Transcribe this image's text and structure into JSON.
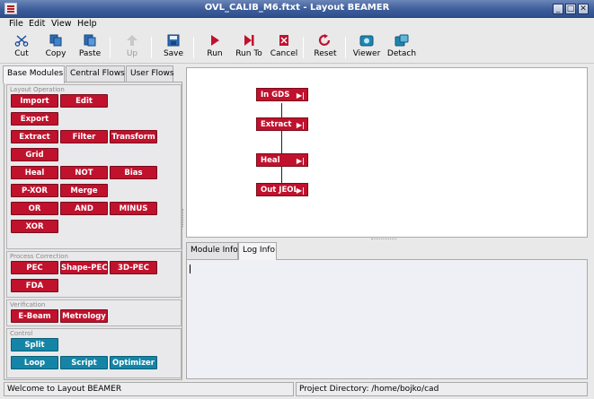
{
  "window": {
    "title": "OVL_CALIB_M6.ftxt - Layout BEAMER"
  },
  "menu": [
    "File",
    "Edit",
    "View",
    "Help"
  ],
  "toolbar": {
    "cut": "Cut",
    "copy": "Copy",
    "paste": "Paste",
    "up": "Up",
    "save": "Save",
    "run": "Run",
    "run_to": "Run To",
    "cancel": "Cancel",
    "reset": "Reset",
    "viewer": "Viewer",
    "detach": "Detach"
  },
  "left_tabs": [
    "Base Modules",
    "Central Flows",
    "User Flows"
  ],
  "groups": {
    "layout_operation": {
      "title": "Layout Operation",
      "modules": [
        "Import",
        "Edit",
        "Export",
        "Extract",
        "Filter",
        "Transform",
        "Grid",
        "Heal",
        "NOT",
        "Bias",
        "P-XOR",
        "Merge",
        "OR",
        "AND",
        "MINUS",
        "XOR"
      ]
    },
    "process_correction": {
      "title": "Process Correction",
      "modules": [
        "PEC",
        "Shape-PEC",
        "3D-PEC",
        "FDA"
      ]
    },
    "verification": {
      "title": "Verification",
      "modules": [
        "E-Beam",
        "Metrology"
      ]
    },
    "control": {
      "title": "Control",
      "modules": [
        "Split",
        "Loop",
        "Script",
        "Optimizer"
      ]
    }
  },
  "flow_nodes": [
    "In GDS",
    "Extract",
    "Heal",
    "Out JEOL"
  ],
  "right_tabs": [
    "Module Info",
    "Log Info"
  ],
  "status": {
    "message": "Welcome to Layout BEAMER",
    "project": "Project Directory: /home/bojko/cad"
  },
  "colors": {
    "module": "#c0122d",
    "control": "#1485a7",
    "titlebar": "#3d5e9a"
  }
}
